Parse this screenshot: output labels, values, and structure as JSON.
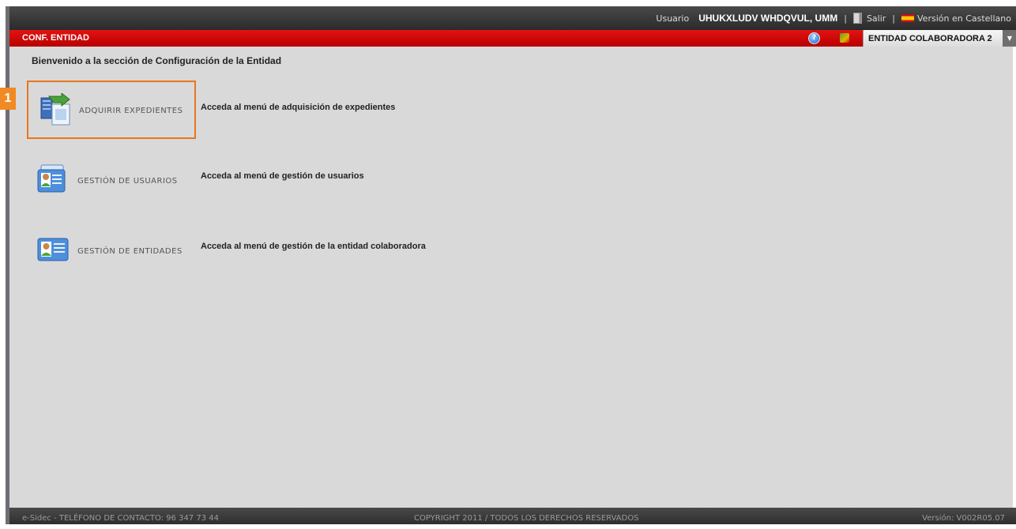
{
  "topbar": {
    "user_label": "Usuario",
    "user_name": "UHUKXLUDV WHDQVUL, UMM",
    "logout_label": "Salir",
    "language_label": "Versión en Castellano"
  },
  "section_bar": {
    "title": "CONF. ENTIDAD",
    "entity_selected": "ENTIDAD COLABORADORA 2"
  },
  "content": {
    "welcome": "Bienvenido a la sección de Configuración de la Entidad",
    "menu": [
      {
        "label": "ADQUIRIR EXPEDIENTES",
        "description": "Acceda al menú de adquisición de expedientes",
        "icon": "acquire-files-icon"
      },
      {
        "label": "GESTIÓN DE USUARIOS",
        "description": "Acceda al menú de gestión de usuarios",
        "icon": "users-icon"
      },
      {
        "label": "GESTIÓN DE ENTIDADES",
        "description": "Acceda al menú de gestión de la entidad colaboradora",
        "icon": "entity-card-icon"
      }
    ]
  },
  "step_badge": "1",
  "footer": {
    "contact": "e-Sidec - TELÉFONO DE CONTACTO: 96 347 73 44",
    "copyright": "COPYRIGHT 2011 / TODOS LOS DERECHOS RESERVADOS",
    "version": "Versión: V002R05.07"
  },
  "colors": {
    "section_bar": "#cc0000",
    "highlight": "#e8761f",
    "content_bg": "#d9d9d9"
  }
}
